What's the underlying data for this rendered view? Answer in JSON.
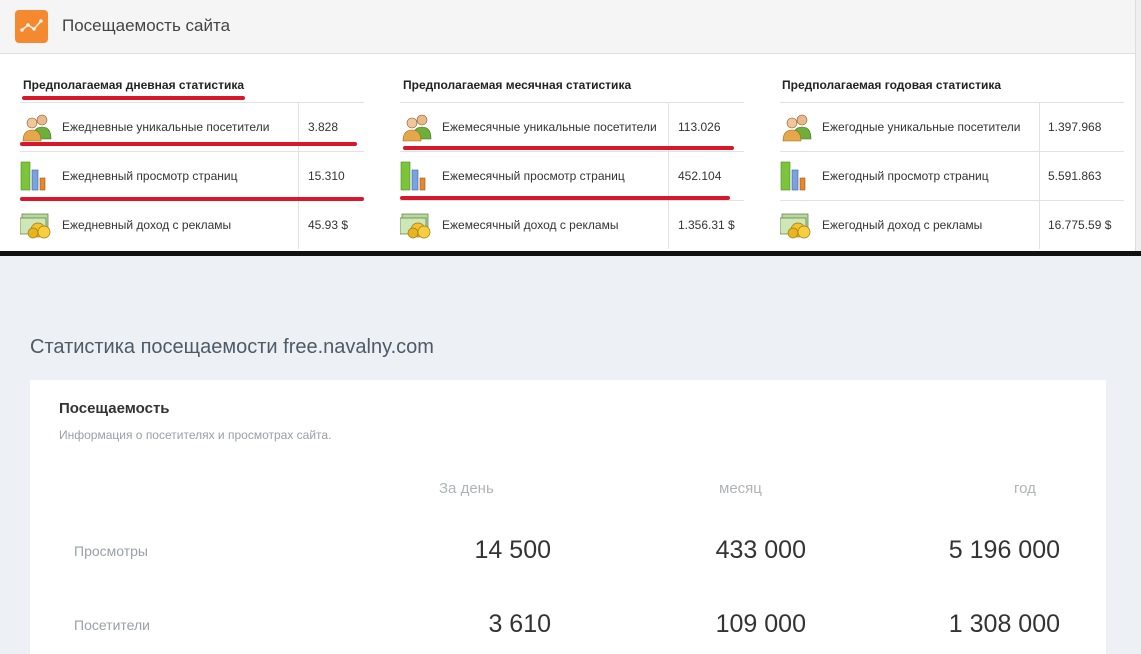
{
  "header": {
    "title": "Посещаемость сайта",
    "icon": "line-chart-icon",
    "accent": "#f4892f"
  },
  "columns": [
    {
      "title": "Предполагаемая дневная статистика",
      "rows": [
        {
          "icon": "visitors-icon",
          "label": "Ежедневные уникальные посетители",
          "value": "3.828"
        },
        {
          "icon": "bar-chart-icon",
          "label": "Ежедневный просмотр страниц",
          "value": "15.310"
        },
        {
          "icon": "money-icon",
          "label": "Ежедневный доход с рекламы",
          "value": "45.93 $"
        }
      ]
    },
    {
      "title": "Предполагаемая месячная статистика",
      "rows": [
        {
          "icon": "visitors-icon",
          "label": "Ежемесячные уникальные посетители",
          "value": "113.026"
        },
        {
          "icon": "bar-chart-icon",
          "label": "Ежемесячный просмотр страниц",
          "value": "452.104"
        },
        {
          "icon": "money-icon",
          "label": "Ежемесячный доход с рекламы",
          "value": "1.356.31 $"
        }
      ]
    },
    {
      "title": "Предполагаемая годовая статистика",
      "rows": [
        {
          "icon": "visitors-icon",
          "label": "Ежегодные уникальные посетители",
          "value": "1.397.968"
        },
        {
          "icon": "bar-chart-icon",
          "label": "Ежегодный просмотр страниц",
          "value": "5.591.863"
        },
        {
          "icon": "money-icon",
          "label": "Ежегодный доход с рекламы",
          "value": "16.775.59 $"
        }
      ]
    }
  ],
  "highlight_color": "#d8182a",
  "traffic": {
    "page_title": "Статистика посещаемости free.navalny.com",
    "card_title": "Посещаемость",
    "card_subtitle": "Информация о посетителях и просмотрах сайта.",
    "headers": [
      "За день",
      "месяц",
      "год"
    ],
    "rows": [
      {
        "label": "Просмотры",
        "values": [
          "14 500",
          "433 000",
          "5 196 000"
        ]
      },
      {
        "label": "Посетители",
        "values": [
          "3 610",
          "109 000",
          "1 308 000"
        ]
      }
    ]
  }
}
